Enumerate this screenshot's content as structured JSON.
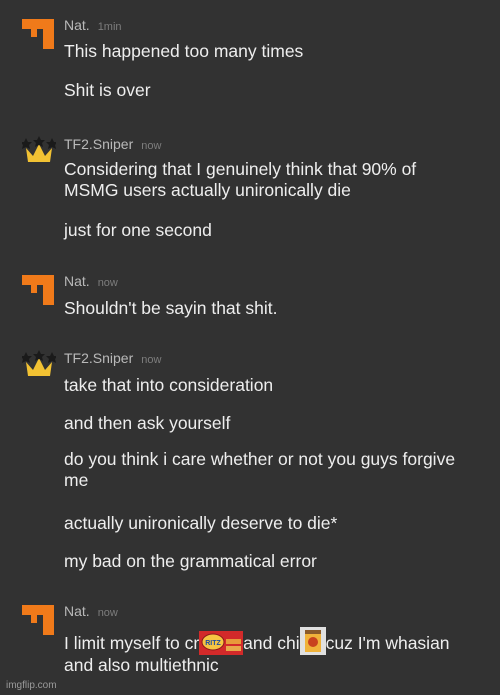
{
  "colors": {
    "background": "#323232",
    "text": "#eeeeee",
    "username": "#b9b9b9",
    "timestamp": "#7d7d7d",
    "orange_avatar": "#f07a1a",
    "crown_gold": "#f2c233"
  },
  "messages": [
    {
      "user": "Nat.",
      "time": "1min",
      "avatar": "orange-block-icon",
      "lines": [
        "This happened too many times",
        "Shit is over"
      ]
    },
    {
      "user": "TF2.Sniper",
      "time": "now",
      "avatar": "crown-icon",
      "lines": [
        "Considering that I genuinely think that 90% of MSMG users actually unironically die",
        "just for one second"
      ]
    },
    {
      "user": "Nat.",
      "time": "now",
      "avatar": "orange-block-icon",
      "lines": [
        "Shouldn't be sayin that shit."
      ]
    },
    {
      "user": "TF2.Sniper",
      "time": "now",
      "avatar": "crown-icon",
      "lines": [
        "take that into consideration",
        "and then ask yourself",
        "do you think i care whether or not you guys forgive me",
        "actually unironically deserve to die*",
        "my bad on the grammatical error"
      ]
    },
    {
      "user": "Nat.",
      "time": "now",
      "avatar": "orange-block-icon",
      "rich_line": {
        "part1": "I limit myself to cr",
        "img1": "ritz-crackers-image",
        "img1_text": "RITZ",
        "part2": "and chi",
        "img2": "chips-bag-image",
        "part3": "cuz I'm whasian and also multiethnic"
      }
    }
  ],
  "watermark": "imgflip.com"
}
